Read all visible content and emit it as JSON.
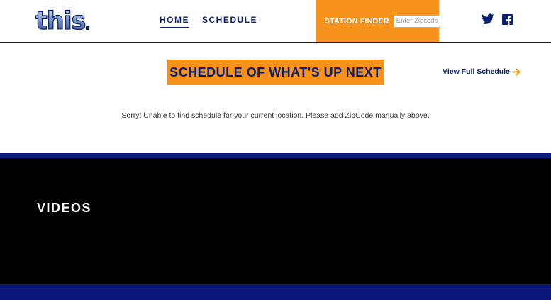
{
  "header": {
    "logo": {
      "text": "this",
      "dot": "."
    },
    "nav": [
      {
        "label": "HOME",
        "active": true
      },
      {
        "label": "SCHEDULE",
        "active": false
      }
    ],
    "station_finder": {
      "label": "STATION FINDER",
      "zip_placeholder": "Enter Zipcode",
      "zip_value": ""
    },
    "social": [
      {
        "icon": "twitter-icon"
      },
      {
        "icon": "facebook-icon"
      }
    ]
  },
  "schedule": {
    "title": "SCHEDULE OF WHAT'S UP NEXT",
    "view_full_label": "View Full Schedule",
    "message": "Sorry! Unable to find schedule for your current location. Please add ZipCode manually above."
  },
  "videos": {
    "title": "VIDEOS"
  },
  "colors": {
    "accent_orange": "#f7931d",
    "brand_navy": "#0a1f6b",
    "band_blue": "#0a1778",
    "videos_bg": "#000000"
  }
}
